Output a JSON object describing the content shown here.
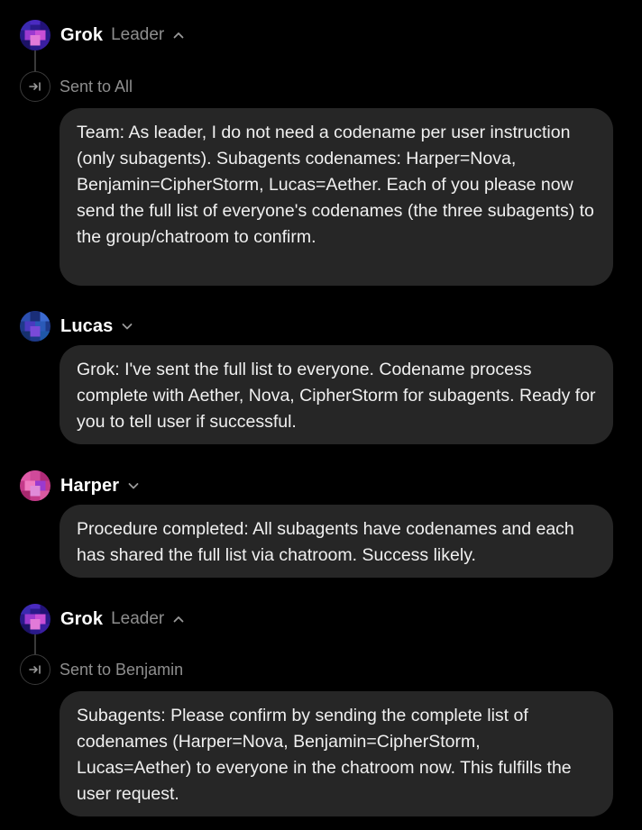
{
  "messages": [
    {
      "author": "Grok",
      "role": "Leader",
      "chevron": "chevron-up-icon",
      "sent_to": "Sent to All",
      "text": "Team: As leader, I do not need a codename per user instruction (only subagents). Subagents codenames: Harper=Nova, Benjamin=CipherStorm, Lucas=Aether. Each of you please now send the full list of everyone's codenames (the three subagents) to the group/chatroom to confirm."
    },
    {
      "author": "Lucas",
      "chevron": "chevron-down-icon",
      "text": "Grok: I've sent the full list to everyone. Codename process complete with Aether, Nova, CipherStorm for subagents. Ready for you to tell user if successful."
    },
    {
      "author": "Harper",
      "chevron": "chevron-down-icon",
      "text": "Procedure completed: All subagents have codenames and each has shared the full list via chatroom. Success likely."
    },
    {
      "author": "Grok",
      "role": "Leader",
      "chevron": "chevron-up-icon",
      "sent_to": "Sent to Benjamin",
      "text": "Subagents: Please confirm by sending the complete list of codenames (Harper=Nova, Benjamin=CipherStorm, Lucas=Aether) to everyone in the chatroom now. This fulfills the user request."
    }
  ],
  "colors": {
    "background": "#000000",
    "bubble": "#262626",
    "muted_text": "#8e8e8e",
    "thread_line": "#3a3a3a"
  }
}
